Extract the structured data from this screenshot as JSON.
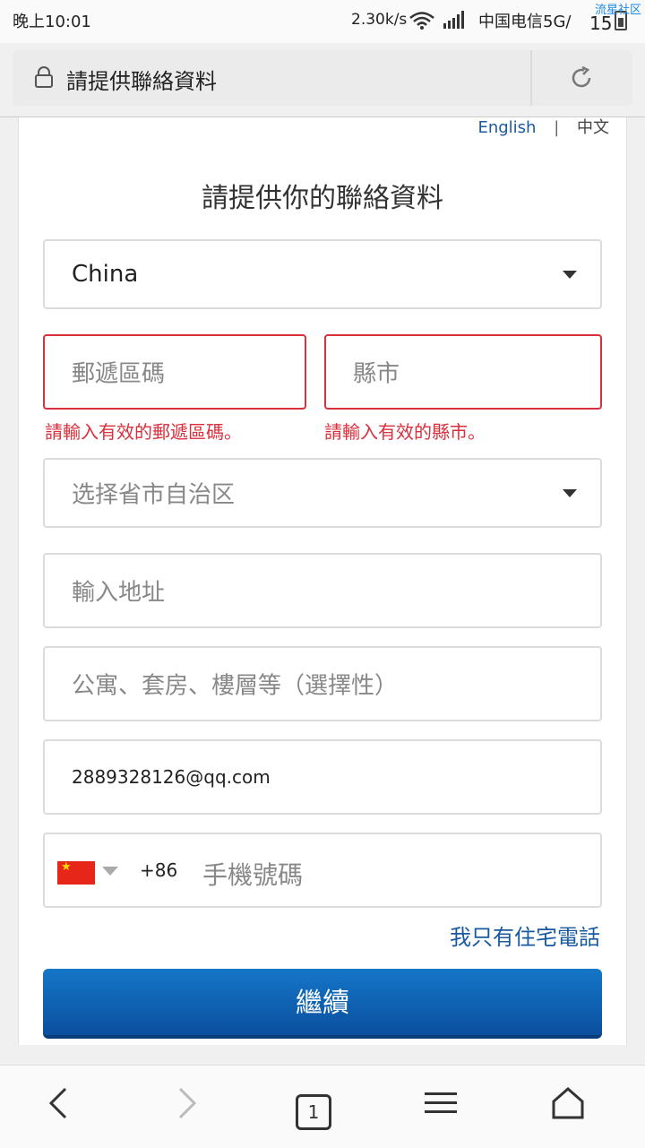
{
  "status_bar": {
    "time": "晚上10:01",
    "speed": "2.30k/s",
    "carrier": "中国电信5G/",
    "battery": "15",
    "watermark": "流星社区"
  },
  "browser": {
    "title": "請提供聯絡資料"
  },
  "language": {
    "english": "English",
    "separator": "|",
    "chinese": "中文"
  },
  "form": {
    "heading": "請提供你的聯絡資料",
    "country_value": "China",
    "postal_placeholder": "郵遞區碼",
    "city_placeholder": "縣市",
    "postal_error": "請輸入有效的郵遞區碼。",
    "city_error": "請輸入有效的縣市。",
    "province_placeholder": "选择省市自治区",
    "address_placeholder": "輸入地址",
    "address2_placeholder": "公寓、套房、樓層等（選擇性）",
    "email_value": "2889328126@qq.com",
    "phone_code": "+86",
    "phone_placeholder": "手機號碼",
    "home_phone_link": "我只有住宅電話",
    "continue_label": "繼續"
  },
  "nav": {
    "tabs_count": "1"
  }
}
